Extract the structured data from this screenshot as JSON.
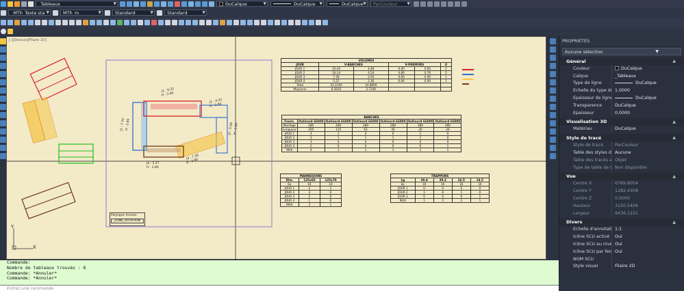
{
  "toolbar1": {
    "layer_value": "_Tableaux",
    "color_value": "DuCalque",
    "linetype_value": "DuCalque",
    "lineweight_value": "DuCalque",
    "plotstyle_value": "ParCouleur"
  },
  "toolbar2": {
    "text_style": "_MTh_Texte sta",
    "dim_style": "MTh_m",
    "table_style": "Standard",
    "multileader_style": "Standard"
  },
  "viewport_label": "[-][Dessus][Filaire 2D]",
  "drawing": {
    "volumes": {
      "title": "VOLUMES",
      "header": [
        "JOUR",
        "V-BANCHES",
        "",
        "V-PREMURS",
        "",
        "U"
      ],
      "rows": [
        [
          "JOUR 1",
          "10.44",
          "4.48",
          "0.00",
          "0.00",
          "2"
        ],
        [
          "JOUR 2",
          "10.14",
          "4.54",
          "4.80",
          "0.76",
          "5"
        ],
        [
          "JOUR 3",
          "7.36",
          "3.50",
          "0.00",
          "0.00",
          "1"
        ],
        [
          "JOUR 4",
          "5.27",
          "2.36",
          "0.00",
          "0.00",
          "1"
        ],
        [
          "Total",
          "33.2100",
          "14.8800",
          "",
          "",
          ""
        ],
        [
          "Moyenne",
          "8.3025",
          "3.7200",
          "",
          "",
          ""
        ]
      ]
    },
    "banches": {
      "title": "BANCHES",
      "header": [
        "Fourn.",
        "Outinord 66000",
        "Outinord 66000",
        "Outinord 66000",
        "Outinord 66000",
        "Outinord 66000",
        "Outinord 66000"
      ],
      "rows": [
        [
          "Montage",
          "280",
          "280",
          "280",
          "280",
          "280",
          "280"
        ],
        [
          "Longueur",
          "250",
          "125",
          "62",
          "40",
          "30",
          "20"
        ],
        [
          "JOUR 1",
          "4",
          "1",
          "0",
          "0",
          "1",
          "0"
        ],
        [
          "JOUR 2",
          "3",
          "1",
          "1",
          "1",
          "1",
          "0"
        ],
        [
          "JOUR 3",
          "3",
          "0",
          "0",
          "0",
          "0",
          "0"
        ],
        [
          "JOUR 4",
          "2",
          "0",
          "0",
          "0",
          "0",
          "1"
        ],
        [
          "MAX",
          "4",
          "1",
          "1",
          "1",
          "1",
          "1"
        ]
      ]
    },
    "mannequins": {
      "title": "MANNEQUINS",
      "header": [
        "Dim.",
        "125x60",
        "125x70"
      ],
      "rows": [
        [
          "Ep",
          "16",
          "16"
        ],
        [
          "JOUR 1",
          "2",
          "1"
        ],
        [
          "JOUR 2",
          "3",
          "0"
        ],
        [
          "JOUR 3",
          "2",
          "0"
        ],
        [
          "JOUR 4",
          "1",
          "0"
        ],
        [
          "MAX",
          "3",
          "1"
        ]
      ]
    },
    "trappons": {
      "title": "TRAPPONS",
      "header": [
        "Lg",
        "39.4",
        "39.2",
        "16.5",
        "14.5"
      ],
      "rows": [
        [
          "Ep",
          "16",
          "16",
          "16",
          "16"
        ],
        [
          "JOUR 1",
          "0",
          "0",
          "0",
          "0"
        ],
        [
          "JOUR 2",
          "1",
          "0",
          "1",
          "0"
        ],
        [
          "JOUR 3",
          "0",
          "0",
          "0",
          "1"
        ],
        [
          "MAX",
          "1",
          "2",
          "2",
          "1"
        ]
      ]
    },
    "poly_label_1": "Polyligne fermée",
    "poly_label_2": "_ZONE_ROTATION",
    "dims": [
      "J1 : 6.22",
      "H : 2.80",
      "J1 : 4.22",
      "H : 2.80",
      "J1 : 7.70",
      "H : 2.80",
      "J4 : 5.27",
      "H : 2.80",
      "J3 : 7.26",
      "H : 2.80",
      "J2 : 5.56",
      "H : 2.80"
    ],
    "ucs_y": "Y",
    "ucs_x": "X"
  },
  "properties": {
    "title": "PROPRIÉTÉS",
    "selection": "Aucune sélection",
    "sections": [
      {
        "name": "Général",
        "rows": [
          {
            "k": "Couleur",
            "v": "DuCalque",
            "swatch": true
          },
          {
            "k": "Calque",
            "v": "_Tableaux"
          },
          {
            "k": "Type de ligne",
            "v": "DuCalque",
            "line": true
          },
          {
            "k": "Echelle du type de li...",
            "v": "1.0000"
          },
          {
            "k": "Epaisseur de ligne",
            "v": "DuCalque",
            "line": true
          },
          {
            "k": "Transparence",
            "v": "DuCalque"
          },
          {
            "k": "Epaisseur",
            "v": "0.0000"
          }
        ]
      },
      {
        "name": "Visualisation 3D",
        "rows": [
          {
            "k": "Matériau",
            "v": "DuCalque"
          }
        ]
      },
      {
        "name": "Style de tracé",
        "rows": [
          {
            "k": "Style de tracé",
            "v": "ParCouleur",
            "dim": true
          },
          {
            "k": "Table des styles de tr...",
            "v": "Aucune"
          },
          {
            "k": "Table des tracés atta...",
            "v": "Objet",
            "dim": true
          },
          {
            "k": "Type de table de tracé",
            "v": "Non disponible",
            "dim": true
          }
        ]
      },
      {
        "name": "Vue",
        "rows": [
          {
            "k": "Centre X",
            "v": "6769.8054",
            "dim": true
          },
          {
            "k": "Centre Y",
            "v": "1282.4308",
            "dim": true
          },
          {
            "k": "Centre Z",
            "v": "0.0000",
            "dim": true
          },
          {
            "k": "Hauteur",
            "v": "3150.5406",
            "dim": true
          },
          {
            "k": "Largeur",
            "v": "9436.1221",
            "dim": true
          }
        ]
      },
      {
        "name": "Divers",
        "rows": [
          {
            "k": "Echelle d'annotation",
            "v": "1:1"
          },
          {
            "k": "Icône SCU activé",
            "v": "Oui"
          },
          {
            "k": "Icône SCU au niveau...",
            "v": "Oui"
          },
          {
            "k": "Icône SCU par fenêtre",
            "v": "Oui"
          },
          {
            "k": "NOM SCU",
            "v": ""
          },
          {
            "k": "Style visuel",
            "v": "Filaire 2D"
          }
        ]
      }
    ]
  },
  "command": {
    "lines": [
      "Commande:",
      "Nombre de tableaux trouvés : 6",
      "Commande: *Annuler*",
      "Commande: *Annuler*"
    ],
    "placeholder": "Entrez une commande"
  }
}
